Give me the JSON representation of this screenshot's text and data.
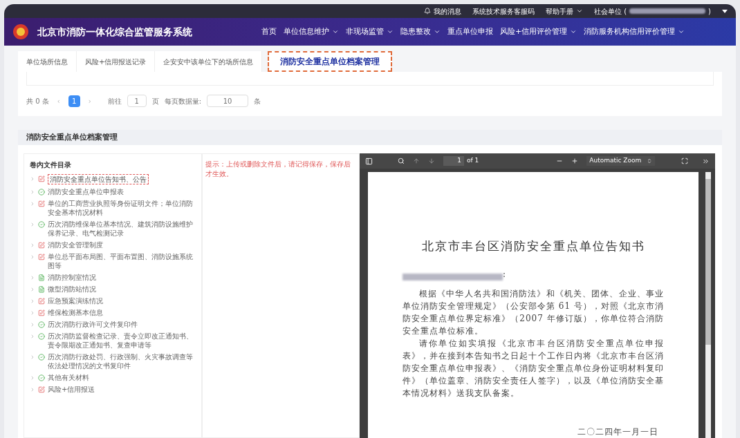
{
  "top_bar": {
    "links": [
      "我的消息",
      "系统技术服务客服码",
      "帮助手册",
      "社会单位 ("
    ],
    "closing": ")"
  },
  "nav": {
    "title": "北京市消防一体化综合监管服务系统",
    "items": [
      {
        "label": "首页",
        "dropdown": false
      },
      {
        "label": "单位信息维护",
        "dropdown": true
      },
      {
        "label": "非现场监管",
        "dropdown": true
      },
      {
        "label": "隐患整改",
        "dropdown": true
      },
      {
        "label": "重点单位申报",
        "dropdown": false
      },
      {
        "label": "风险+信用评价管理",
        "dropdown": true
      },
      {
        "label": "消防服务机构信用评价管理",
        "dropdown": true
      }
    ]
  },
  "tabs": [
    {
      "label": "单位场所信息",
      "selected": false
    },
    {
      "label": "风险+信用报送记录",
      "selected": false
    },
    {
      "label": "企安安中该单位下的场所信息",
      "selected": false
    },
    {
      "label": "消防安全重点单位档案管理",
      "selected": true
    }
  ],
  "pagination": {
    "total": "共 0 条",
    "prev": "‹",
    "pages": [
      {
        "label": "1",
        "selected": true
      }
    ],
    "next": "›",
    "goto_label": "前往",
    "goto_value": "1",
    "goto_unit": "页",
    "size_label": "每页数据量:",
    "size_value": "10",
    "size_unit": "条"
  },
  "section": {
    "title": "消防安全重点单位档案管理"
  },
  "catalog": {
    "title": "卷内文件目录",
    "items": [
      {
        "kind": "edit",
        "label": "消防安全重点单位告知书、公告",
        "selected": true
      },
      {
        "kind": "done",
        "label": "消防安全重点单位申报表",
        "selected": false
      },
      {
        "kind": "edit",
        "label": "单位的工商营业执照等身份证明文件；单位消防安全基本情况材料",
        "selected": false
      },
      {
        "kind": "done",
        "label": "历次消防维保单位基本情况、建筑消防设施维护保养记录、电气检测记录",
        "selected": false
      },
      {
        "kind": "edit",
        "label": "消防安全管理制度",
        "selected": false
      },
      {
        "kind": "edit",
        "label": "单位总平面布局图、平面布置图、消防设施系统图等",
        "selected": false
      },
      {
        "kind": "file",
        "label": "消防控制室情况",
        "selected": false
      },
      {
        "kind": "file",
        "label": "微型消防站情况",
        "selected": false
      },
      {
        "kind": "edit",
        "label": "应急预案演练情况",
        "selected": false
      },
      {
        "kind": "edit",
        "label": "维保检测基本信息",
        "selected": false
      },
      {
        "kind": "done",
        "label": "历次消防行政许可文件复印件",
        "selected": false
      },
      {
        "kind": "done",
        "label": "历次消防监督检查记录、责令立即改正通知书、责令限期改正通知书、复查申请等",
        "selected": false
      },
      {
        "kind": "done",
        "label": "历次消防行政处罚、行政强制、火灾事故调查等依法处理情况的文书复印件",
        "selected": false
      },
      {
        "kind": "done",
        "label": "其他有关材料",
        "selected": false
      },
      {
        "kind": "edit",
        "label": "风险+信用报送",
        "selected": false
      }
    ]
  },
  "hint": "提示：上传或删除文件后，请记得保存，保存后才生效。",
  "viewer": {
    "page_value": "1",
    "page_total": "of 1",
    "zoom": "Automatic Zoom",
    "document": {
      "title": "北京市丰台区消防安全重点单位告知书",
      "paragraphs": [
        "根据《中华人名共和国消防法》和《机关、团体、企业、事业单位消防安全管理规定》（公安部令第 61 号），对照《北京市消防安全重点单位界定标准》（2007 年修订版），你单位符合消防安全重点单位标准。",
        "请你单位如实填报《北京市丰台区消防安全重点单位申报表》，并在接到本告知书之日起十个工作日内将《北京市丰台区消防安全重点单位申报表》、《消防安全重点单位身份证明材料复印件》（单位盖章、消防安全责任人签字），以及《单位消防安全基本情况材料》送我支队备案。"
      ],
      "date": "二〇二四年一月一日",
      "salutation_end": ":"
    }
  }
}
